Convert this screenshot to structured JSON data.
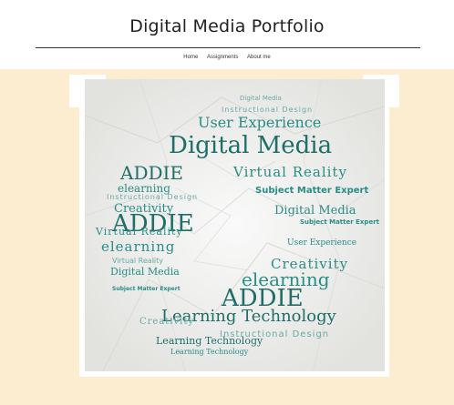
{
  "header": {
    "title": "Digital Media Portfolio",
    "nav": [
      {
        "label": "Home"
      },
      {
        "label": "Assignments"
      },
      {
        "label": "About me"
      }
    ]
  },
  "word_cloud": {
    "words": [
      "Digital Media",
      "Instructional Design",
      "User Experience",
      "Digital Media",
      "ADDIE",
      "elearning",
      "Virtual Reality",
      "Subject Matter Expert",
      "Instructional Design",
      "Creativity",
      "Digital Media",
      "ADDIE",
      "Virtual Reality",
      "Subject Matter Expert",
      "User Experience",
      "elearning",
      "Virtual Reality",
      "Creativity",
      "Digital Media",
      "elearning",
      "Subject Matter Expert",
      "ADDIE",
      "Learning Technology",
      "Creativity",
      "Instructional Design",
      "Learning Technology",
      "Learning Technology"
    ]
  }
}
